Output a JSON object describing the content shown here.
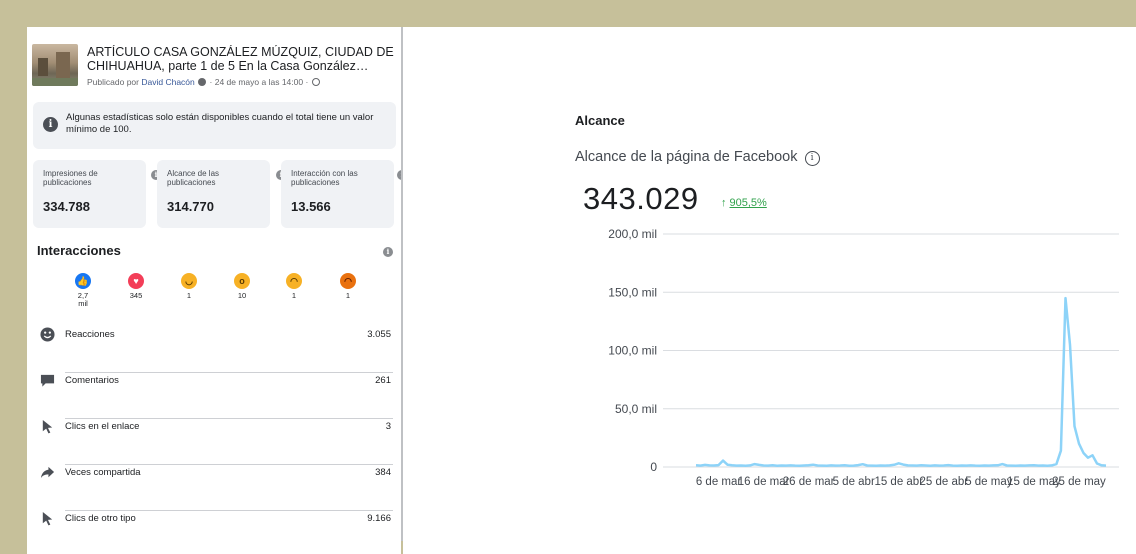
{
  "post": {
    "title": "ARTÍCULO CASA GONZÁLEZ MÚZQUIZ, CIUDAD DE CHIHUAHUA, parte 1 de 5 En la Casa González Múzquiz, la pequeña historia de una casa que narra el esplendor de su tiempo",
    "published_prefix": "Publicado por",
    "author": "David Chacón",
    "date": "24 de mayo a las 14:00"
  },
  "notice": {
    "text": "Algunas estadísticas solo están disponibles cuando el total tiene un valor mínimo de 100."
  },
  "stats": [
    {
      "label": "Impresiones de publicaciones",
      "value": "334.788"
    },
    {
      "label": "Alcance de las publicaciones",
      "value": "314.770"
    },
    {
      "label": "Interacción con las publicaciones",
      "value": "13.566"
    }
  ],
  "interactions": {
    "title": "Interacciones",
    "reactions": [
      {
        "icon": "like-icon",
        "count": "2,7 mil",
        "color": "#1877f2"
      },
      {
        "icon": "love-icon",
        "count": "345",
        "color": "#f33e58"
      },
      {
        "icon": "haha-icon",
        "count": "1",
        "color": "#f7b125"
      },
      {
        "icon": "wow-icon",
        "count": "10",
        "color": "#f7b125"
      },
      {
        "icon": "sad-icon",
        "count": "1",
        "color": "#f7b125"
      },
      {
        "icon": "angry-icon",
        "count": "1",
        "color": "#e9710f"
      }
    ],
    "metrics": [
      {
        "icon": "smiley-icon",
        "label": "Reacciones",
        "value": "3.055"
      },
      {
        "icon": "comment-icon",
        "label": "Comentarios",
        "value": "261"
      },
      {
        "icon": "cursor-icon",
        "label": "Clics en el enlace",
        "value": "3"
      },
      {
        "icon": "share-icon",
        "label": "Veces compartida",
        "value": "384"
      },
      {
        "icon": "cursor-icon",
        "label": "Clics de otro tipo",
        "value": "9.166"
      }
    ]
  },
  "reach": {
    "title": "Alcance",
    "subtitle": "Alcance de la página de Facebook",
    "value": "343.029",
    "change_arrow": "↑",
    "change": "905,5%",
    "change_color": "#31a24c"
  },
  "chart_data": {
    "type": "line",
    "title": "",
    "xlabel": "",
    "ylabel": "",
    "ylim": [
      0,
      200000
    ],
    "y_ticks": [
      0,
      50000,
      100000,
      150000,
      200000
    ],
    "y_tick_labels": [
      "0",
      "50,0 mil",
      "100,0 mil",
      "150,0 mil",
      "200,0 mil"
    ],
    "x_tick_labels": [
      "6 de mar",
      "16 de mar",
      "26 de mar",
      "5 de abr",
      "15 de abr",
      "25 de abr",
      "5 de may",
      "15 de may",
      "25 de may"
    ],
    "grid": true,
    "line_color": "#8dd3f8",
    "x": [
      "1 mar",
      "2 mar",
      "3 mar",
      "4 mar",
      "5 mar",
      "6 mar",
      "7 mar",
      "8 mar",
      "9 mar",
      "10 mar",
      "11 mar",
      "12 mar",
      "13 mar",
      "14 mar",
      "15 mar",
      "16 mar",
      "17 mar",
      "18 mar",
      "19 mar",
      "20 mar",
      "21 mar",
      "22 mar",
      "23 mar",
      "24 mar",
      "25 mar",
      "26 mar",
      "27 mar",
      "28 mar",
      "29 mar",
      "30 mar",
      "31 mar",
      "1 abr",
      "2 abr",
      "3 abr",
      "4 abr",
      "5 abr",
      "6 abr",
      "7 abr",
      "8 abr",
      "9 abr",
      "10 abr",
      "11 abr",
      "12 abr",
      "13 abr",
      "14 abr",
      "15 abr",
      "16 abr",
      "17 abr",
      "18 abr",
      "19 abr",
      "20 abr",
      "21 abr",
      "22 abr",
      "23 abr",
      "24 abr",
      "25 abr",
      "26 abr",
      "27 abr",
      "28 abr",
      "29 abr",
      "30 abr",
      "1 may",
      "2 may",
      "3 may",
      "4 may",
      "5 may",
      "6 may",
      "7 may",
      "8 may",
      "9 may",
      "10 may",
      "11 may",
      "12 may",
      "13 may",
      "14 may",
      "15 may",
      "16 may",
      "17 may",
      "18 may",
      "19 may",
      "20 may",
      "21 may",
      "22 may",
      "23 may",
      "24 may",
      "25 may",
      "26 may",
      "27 may",
      "28 may",
      "29 may",
      "30 may",
      "31 may"
    ],
    "values": [
      1500,
      1200,
      1800,
      1400,
      1300,
      1600,
      5500,
      2000,
      1500,
      1200,
      1300,
      1100,
      1400,
      2500,
      1800,
      1300,
      1200,
      1500,
      1100,
      1300,
      1200,
      1400,
      1200,
      1100,
      1300,
      1500,
      2000,
      1300,
      1200,
      1100,
      1400,
      1200,
      1300,
      1500,
      1100,
      1200,
      1600,
      2400,
      1300,
      1200,
      1100,
      1300,
      1200,
      1400,
      1900,
      3200,
      2100,
      1400,
      1300,
      1200,
      1500,
      1300,
      1100,
      1400,
      1200,
      1300,
      1600,
      1200,
      1100,
      1300,
      1200,
      1400,
      1200,
      1100,
      1300,
      1200,
      1400,
      1500,
      2500,
      1300,
      1200,
      1100,
      1300,
      1200,
      1400,
      1500,
      1200,
      1300,
      1100,
      1400,
      2500,
      14000,
      145000,
      105000,
      35000,
      20000,
      12000,
      8000,
      10000,
      3000,
      1500,
      1200
    ]
  }
}
